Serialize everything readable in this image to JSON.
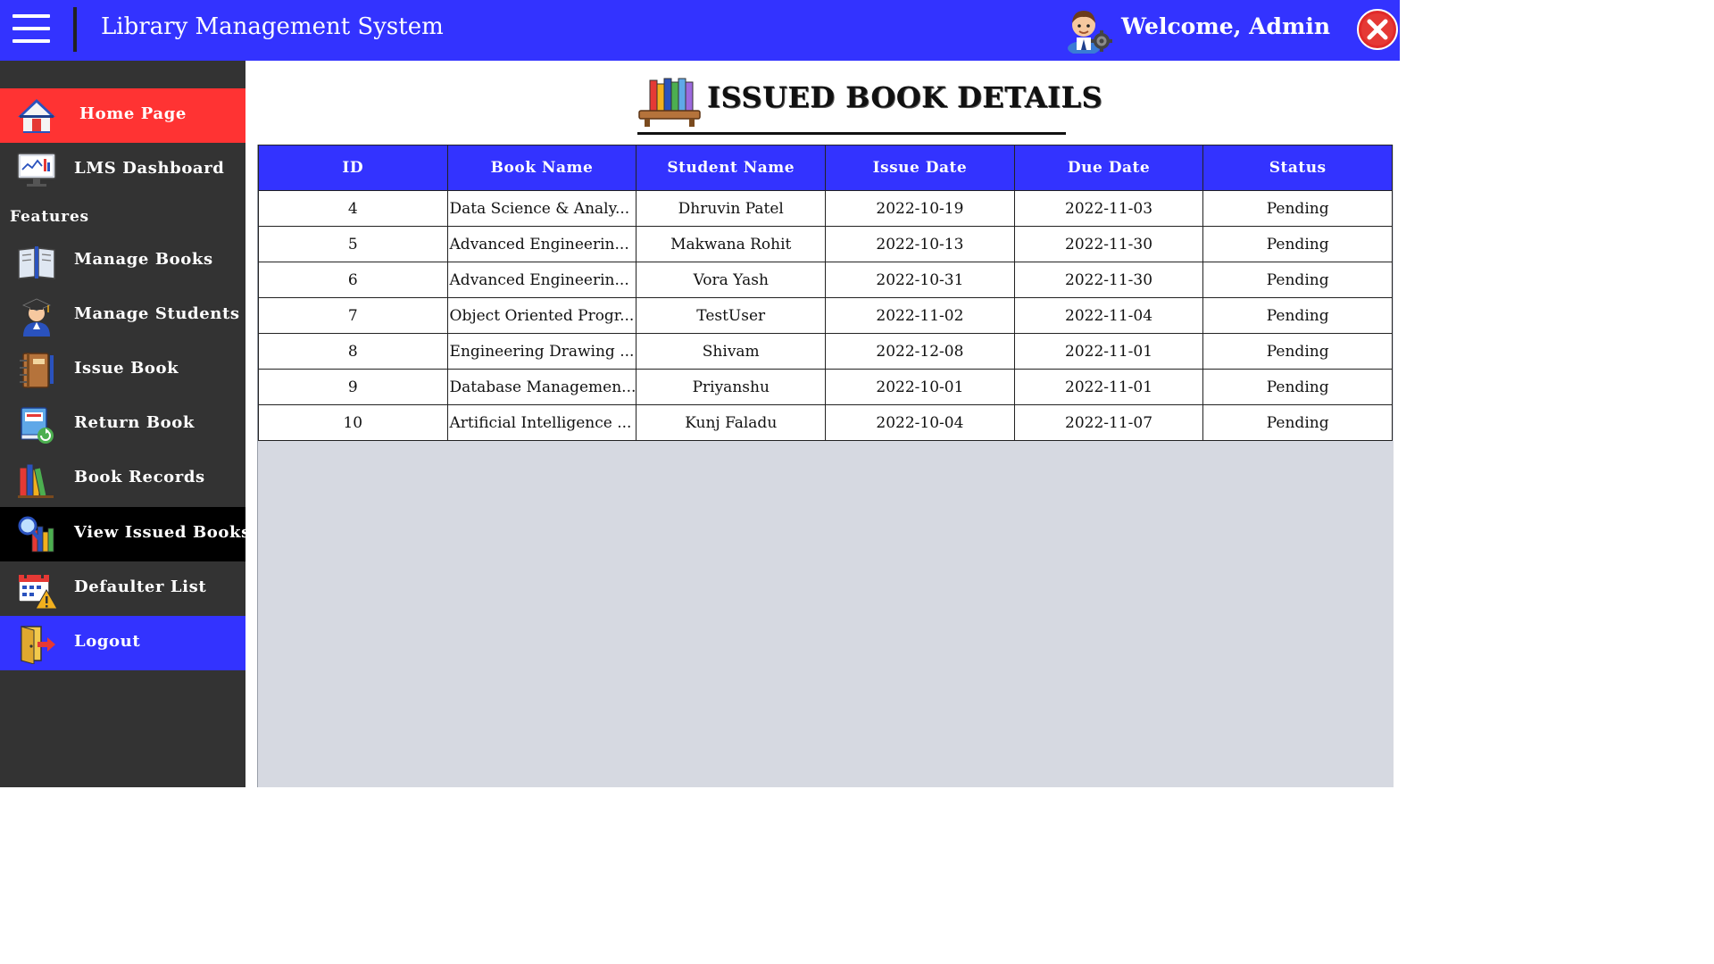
{
  "header": {
    "title": "Library Management System",
    "welcome": "Welcome, Admin"
  },
  "sidebar": {
    "items": [
      {
        "label": "Home Page",
        "icon": "home-icon"
      },
      {
        "label": "LMS Dashboard",
        "icon": "dashboard-monitor-icon"
      }
    ],
    "section_label": "Features",
    "features": [
      {
        "label": "Manage Books",
        "icon": "open-book-icon"
      },
      {
        "label": "Manage Students",
        "icon": "graduate-student-icon"
      },
      {
        "label": "Issue Book",
        "icon": "notebook-icon"
      },
      {
        "label": "Return Book",
        "icon": "return-book-icon"
      },
      {
        "label": "Book Records",
        "icon": "books-shelf-icon"
      },
      {
        "label": "View Issued Books",
        "icon": "search-books-icon"
      },
      {
        "label": "Defaulter List",
        "icon": "calendar-warning-icon"
      },
      {
        "label": "Logout",
        "icon": "exit-door-icon"
      }
    ],
    "active": "View Issued Books"
  },
  "main": {
    "heading": "ISSUED BOOK DETAILS",
    "table": {
      "columns": [
        "ID",
        "Book Name",
        "Student Name",
        "Issue Date",
        "Due Date",
        "Status"
      ],
      "rows": [
        [
          "4",
          "Data Science & Analy...",
          "Dhruvin Patel",
          "2022-10-19",
          "2022-11-03",
          "Pending"
        ],
        [
          "5",
          "Advanced Engineerin...",
          "Makwana Rohit",
          "2022-10-13",
          "2022-11-30",
          "Pending"
        ],
        [
          "6",
          "Advanced Engineerin...",
          "Vora Yash",
          "2022-10-31",
          "2022-11-30",
          "Pending"
        ],
        [
          "7",
          "Object Oriented Progr...",
          "TestUser",
          "2022-11-02",
          "2022-11-04",
          "Pending"
        ],
        [
          "8",
          "Engineering Drawing ...",
          "Shivam",
          "2022-12-08",
          "2022-11-01",
          "Pending"
        ],
        [
          "9",
          "Database Managemen...",
          "Priyanshu",
          "2022-10-01",
          "2022-11-01",
          "Pending"
        ],
        [
          "10",
          "Artificial Intelligence ...",
          "Kunj Faladu",
          "2022-10-04",
          "2022-11-07",
          "Pending"
        ]
      ]
    }
  },
  "colors": {
    "header_bg": "#3333ff",
    "sidebar_bg": "#333333",
    "home_bg": "#ff3333",
    "active_bg": "#000000",
    "logout_bg": "#3333ff",
    "table_header_bg": "#3333ff",
    "empty_area_bg": "#d6d9e1"
  }
}
